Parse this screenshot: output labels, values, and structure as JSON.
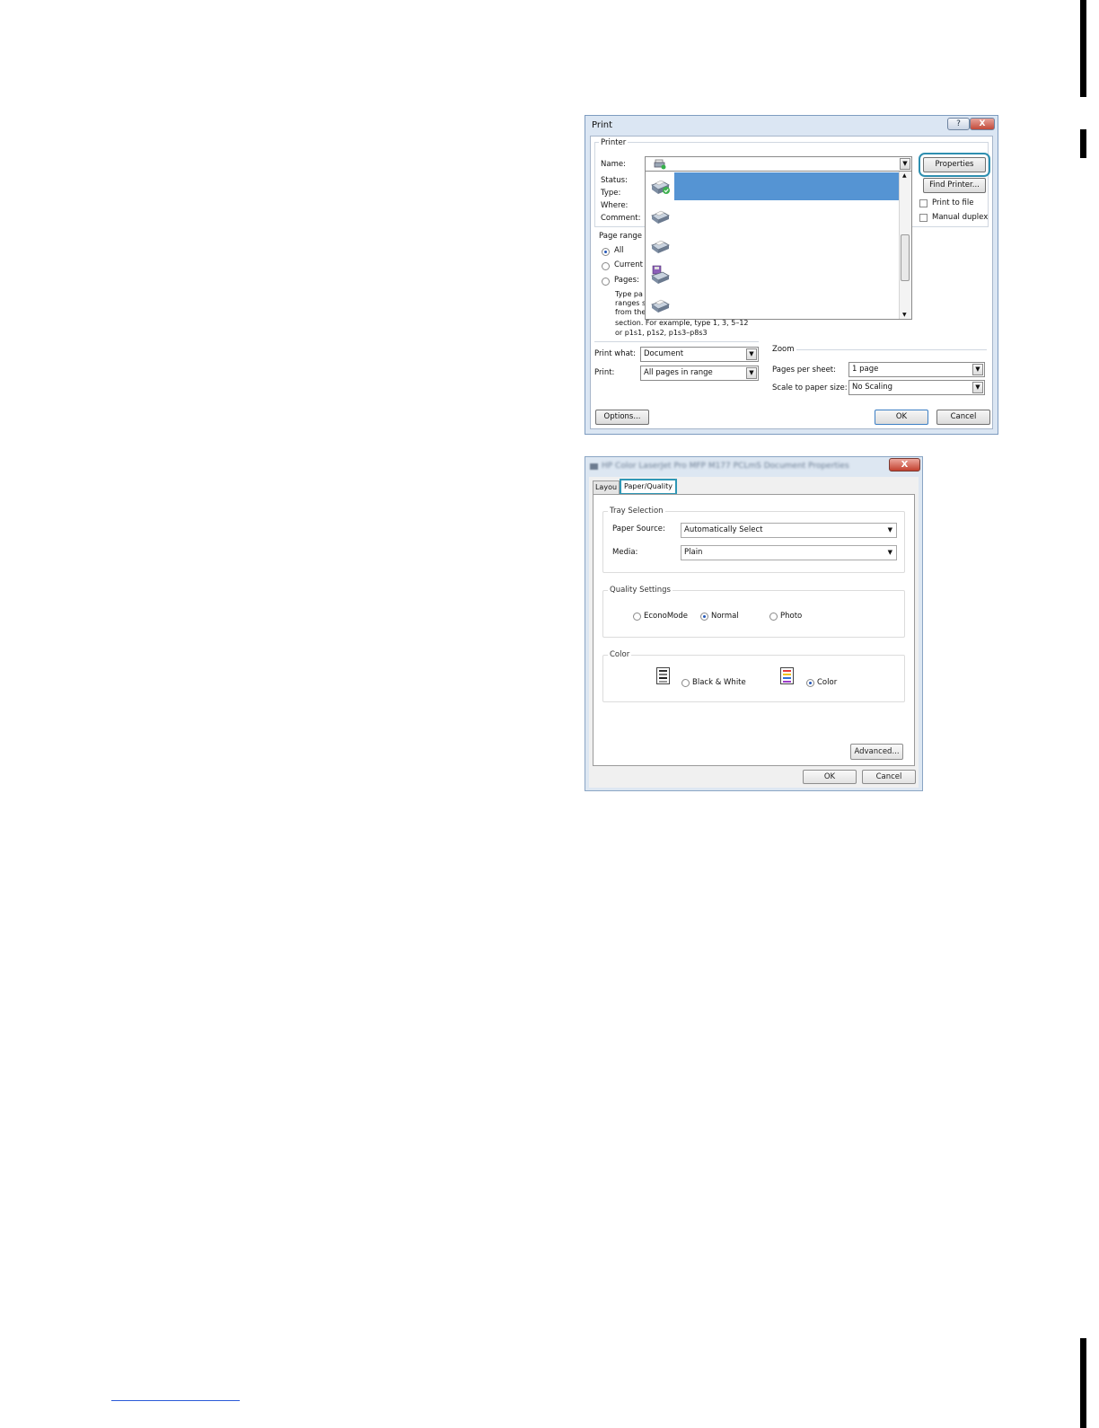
{
  "print_dialog": {
    "title": "Print",
    "help_glyph": "?",
    "close_glyph": "X",
    "printer_group": "Printer",
    "labels": {
      "name": "Name:",
      "status": "Status:",
      "type": "Type:",
      "where": "Where:",
      "comment": "Comment:"
    },
    "properties_button": "Properties",
    "find_printer_button": "Find Printer...",
    "print_to_file": "Print to file",
    "manual_duplex": "Manual duplex",
    "page_range": {
      "legend": "Page range",
      "all": "All",
      "current": "Current",
      "pages": "Pages:",
      "hint_lines": [
        "Type pa",
        "ranges s",
        "from the",
        "section. For example, type 1, 3, 5–12",
        "or p1s1, p1s2, p1s3–p8s3"
      ]
    },
    "print_what_label": "Print what:",
    "print_what_value": "Document",
    "print_label": "Print:",
    "print_value": "All pages in range",
    "zoom": {
      "legend": "Zoom",
      "pages_per_sheet_label": "Pages per sheet:",
      "pages_per_sheet_value": "1 page",
      "scale_label": "Scale to paper size:",
      "scale_value": "No Scaling"
    },
    "options_button": "Options...",
    "ok_button": "OK",
    "cancel_button": "Cancel",
    "dropdown_selected_index": 0,
    "dropdown_icons": [
      "printer-default-icon",
      "printer-icon",
      "printer-icon",
      "fax-printer-icon",
      "printer-icon"
    ]
  },
  "properties_dialog": {
    "title": "HP Color LaserJet Pro MFP M177 PCLmS Document Properties",
    "close_glyph": "X",
    "tabs": [
      "Layou",
      "Paper/Quality"
    ],
    "active_tab": "Paper/Quality",
    "tray_selection": {
      "legend": "Tray Selection",
      "paper_source_label": "Paper Source:",
      "paper_source_value": "Automatically Select",
      "media_label": "Media:",
      "media_value": "Plain"
    },
    "quality_settings": {
      "legend": "Quality Settings",
      "options": [
        "EconoMode",
        "Normal",
        "Photo"
      ],
      "selected": "Normal"
    },
    "color": {
      "legend": "Color",
      "black_white": "Black & White",
      "color": "Color",
      "selected": "Color"
    },
    "advanced_button": "Advanced...",
    "ok_button": "OK",
    "cancel_button": "Cancel"
  },
  "colors": {
    "highlight_outline": "#2f97b5",
    "selection_blue": "#5594d3",
    "dialog_frame": "#dbe6f3",
    "close_red": "#c2402f"
  }
}
